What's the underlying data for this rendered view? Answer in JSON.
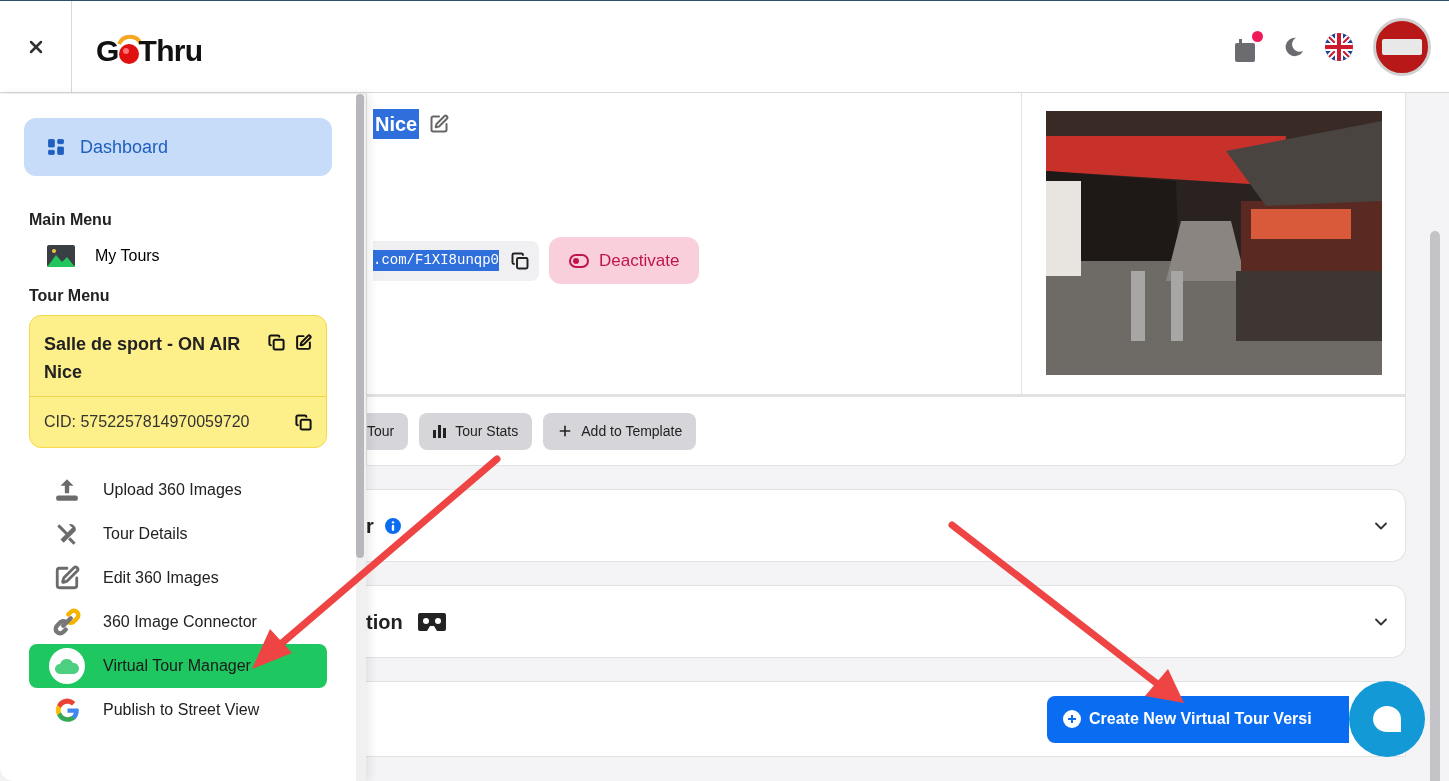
{
  "header": {
    "logo": {
      "prefix": "G",
      "suffix": "Thru"
    },
    "notification": true
  },
  "sidebar": {
    "dashboard": {
      "label": "Dashboard",
      "selected": true
    },
    "main_menu": {
      "title": "Main Menu",
      "items": [
        {
          "label": "My Tours",
          "selected": false
        }
      ]
    },
    "tour_menu": {
      "title": "Tour Menu",
      "tour": {
        "name": "Salle de sport - ON AIR Nice",
        "cid": "CID: 5752257814970059720"
      },
      "items": [
        {
          "label": "Upload 360 Images",
          "selected": false
        },
        {
          "label": "Tour Details",
          "selected": false
        },
        {
          "label": "Edit 360 Images",
          "selected": false
        },
        {
          "label": "360 Image Connector",
          "selected": false
        },
        {
          "label": "Virtual Tour Manager",
          "selected": true
        },
        {
          "label": "Publish to Street View",
          "selected": false
        }
      ]
    }
  },
  "tour": {
    "title": "Nice",
    "url": ".com/F1XI8unqp0",
    "text_selected": true,
    "deactivate": "Deactivate",
    "actions": [
      "Tour",
      "Tour Stats",
      "Add to Template"
    ]
  },
  "sections": [
    {
      "title": "r",
      "expanded": false
    },
    {
      "title": "tion",
      "expanded": false
    }
  ],
  "create_button": "Create New Virtual Tour Versi"
}
